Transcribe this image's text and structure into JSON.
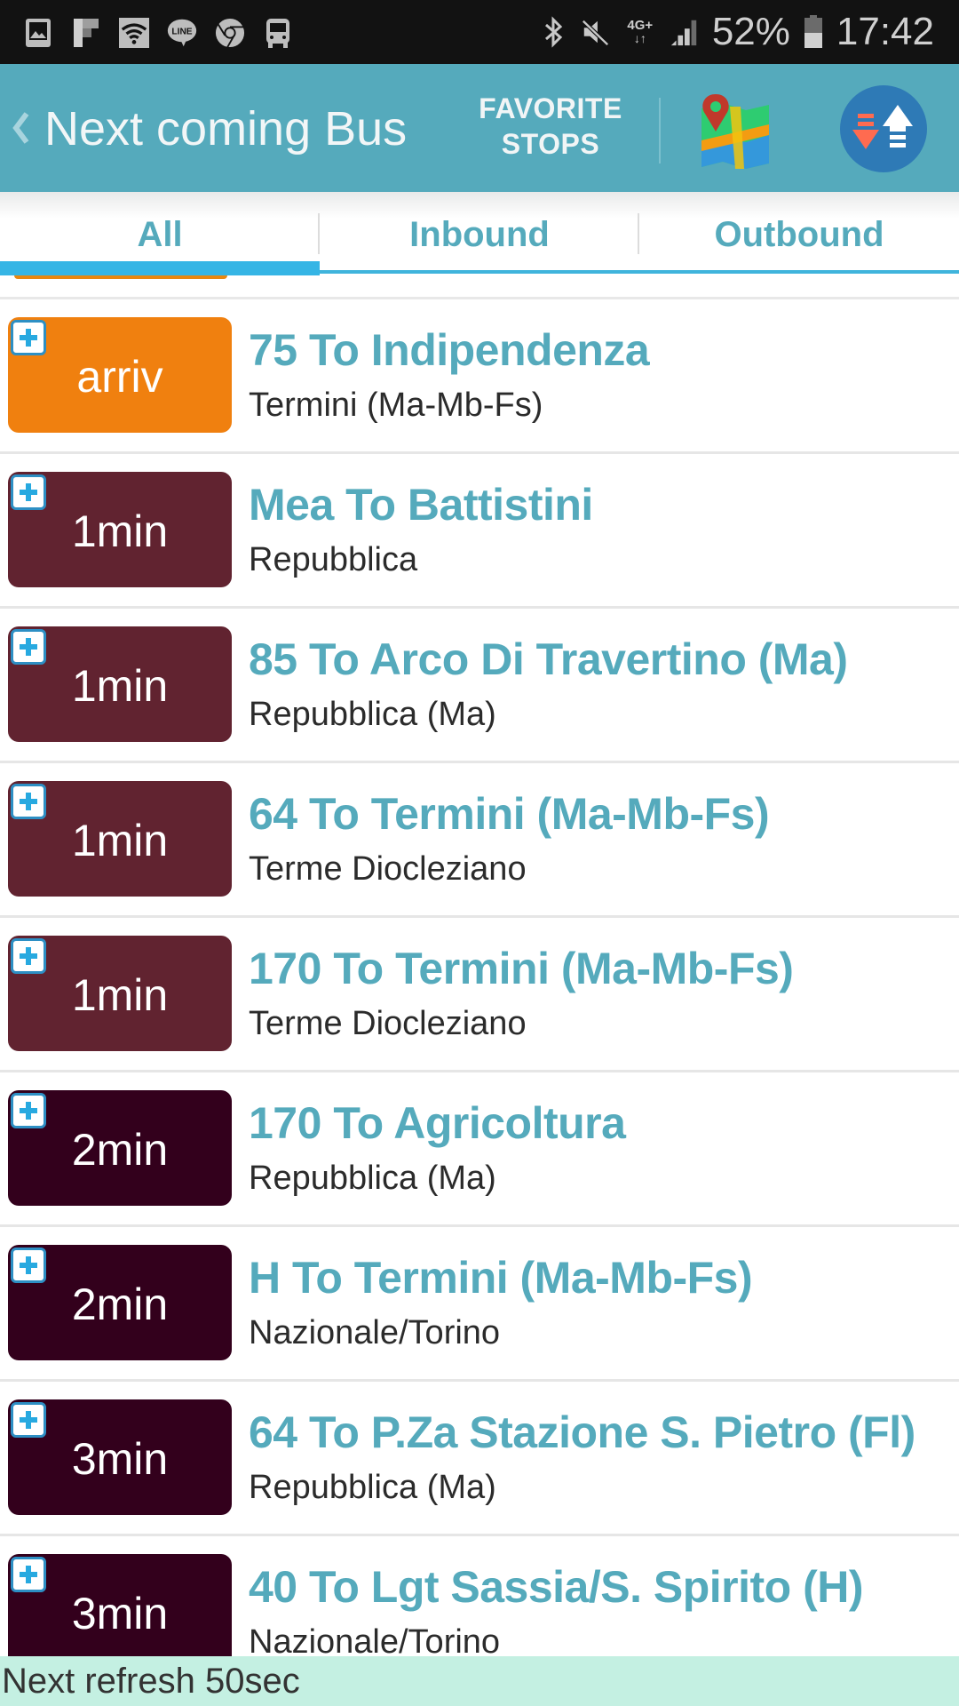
{
  "status_bar": {
    "left_icons": [
      "gallery-icon",
      "flipboard-icon",
      "wifi-icon",
      "line-app-icon",
      "chrome-icon",
      "bus-app-icon"
    ],
    "right_icons": [
      "bluetooth-icon",
      "mute-icon",
      "network-4g-icon",
      "signal-icon"
    ],
    "network_label": "4G+",
    "battery_percent": "52%",
    "battery_level": 0.52,
    "time": "17:42"
  },
  "app_bar": {
    "title": "Next coming Bus",
    "favorite_line1": "FAVORITE",
    "favorite_line2": "STOPS",
    "map_icon": "map-icon",
    "direction_icon": "swap-direction-icon",
    "colors": {
      "background": "#55aabc",
      "title": "#f2f6f7"
    }
  },
  "tabs": [
    {
      "label": "All",
      "active": true
    },
    {
      "label": "Inbound",
      "active": false
    },
    {
      "label": "Outbound",
      "active": false
    }
  ],
  "colors": {
    "accent": "#55aabc",
    "tab_indicator": "#35b5e5",
    "arriving": "#f0800f",
    "soon": "#612330",
    "later": "#33001c",
    "footer_bg": "#c4f0e2"
  },
  "arrivals": [
    {
      "eta": "arriv",
      "route": "75 To Indipendenza",
      "stop": "Termini (Ma-Mb-Fs)",
      "color": "#f0800f"
    },
    {
      "eta": "1min",
      "route": "Mea To Battistini",
      "stop": "Repubblica",
      "color": "#612330"
    },
    {
      "eta": "1min",
      "route": "85 To Arco Di Travertino (Ma)",
      "stop": "Repubblica (Ma)",
      "color": "#612330"
    },
    {
      "eta": "1min",
      "route": "64 To Termini (Ma-Mb-Fs)",
      "stop": "Terme Diocleziano",
      "color": "#612330"
    },
    {
      "eta": "1min",
      "route": "170 To Termini (Ma-Mb-Fs)",
      "stop": "Terme Diocleziano",
      "color": "#612330"
    },
    {
      "eta": "2min",
      "route": "170 To Agricoltura",
      "stop": "Repubblica (Ma)",
      "color": "#33001c"
    },
    {
      "eta": "2min",
      "route": "H To Termini (Ma-Mb-Fs)",
      "stop": "Nazionale/Torino",
      "color": "#33001c"
    },
    {
      "eta": "3min",
      "route": "64 To P.Za Stazione S. Pietro (Fl)",
      "stop": "Repubblica (Ma)",
      "color": "#33001c"
    },
    {
      "eta": "3min",
      "route": "40 To Lgt Sassia/S. Spirito (H)",
      "stop": "Nazionale/Torino",
      "color": "#33001c"
    }
  ],
  "footer": {
    "refresh_text": "Next refresh 50sec"
  }
}
